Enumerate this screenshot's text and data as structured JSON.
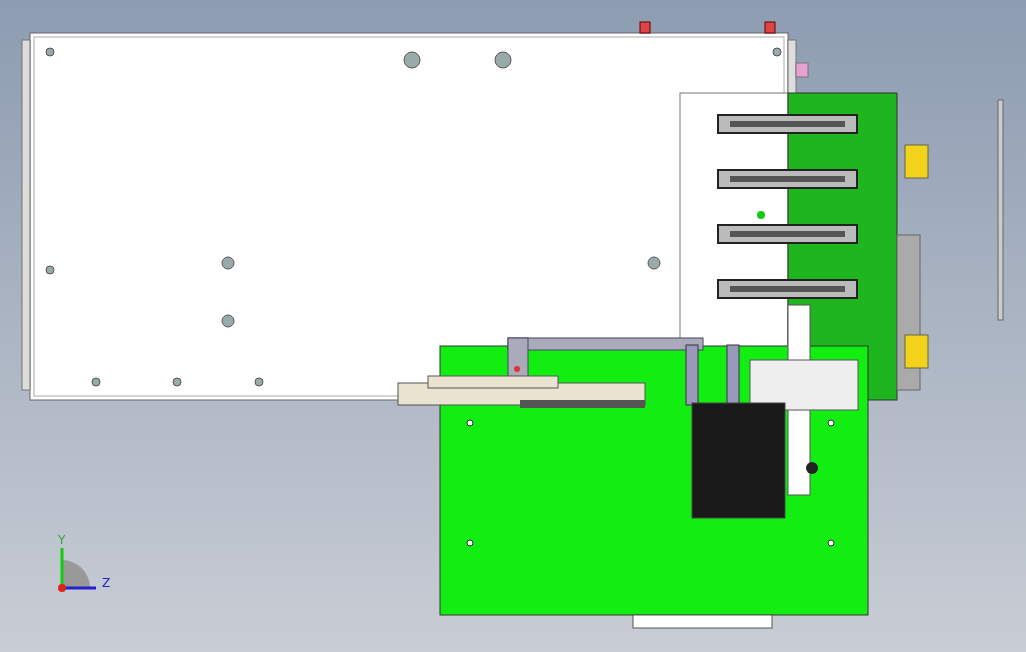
{
  "axis_triad": {
    "y_label": "Y",
    "z_label": "Z"
  }
}
